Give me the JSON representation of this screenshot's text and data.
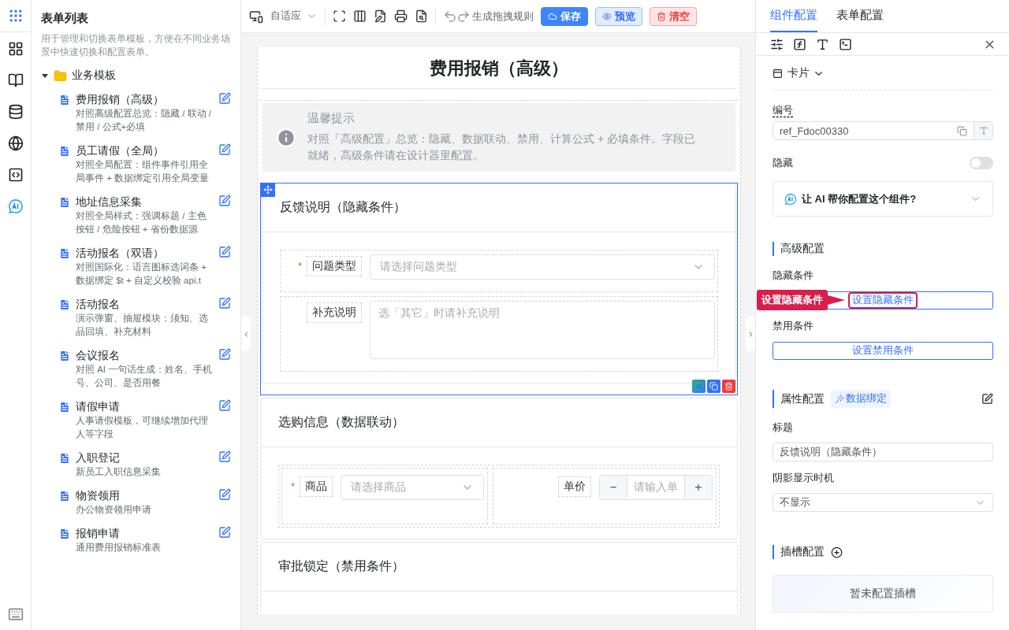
{
  "left_panel": {
    "title": "表单列表",
    "description": "用于管理和切换表单模板，方便在不同业务场景中快速切换和配置表单。",
    "folder": {
      "label": "业务模板",
      "expanded": true,
      "children": [
        {
          "title": "费用报销（高级）",
          "description": "对照高级配置总览：隐藏 / 联动 / 禁用 / 公式+必填"
        },
        {
          "title": "员工请假（全局）",
          "description": "对照全局配置：组件事件引用全局事件 + 数据绑定引用全局变量"
        },
        {
          "title": "地址信息采集",
          "description": "对照全局样式：强调标题 / 主色按钮 / 危险按钮 + 省份数据源"
        },
        {
          "title": "活动报名（双语）",
          "description": "对照国际化：语言图标选词条 + 数据绑定 $t + 自定义校验 api.t"
        },
        {
          "title": "活动报名",
          "description": "演示弹窗、抽屉模块：须知、选品回填、补充材料"
        },
        {
          "title": "会议报名",
          "description": "对照 AI 一句话生成：姓名、手机号、公司、是否用餐"
        },
        {
          "title": "请假申请",
          "description": "人事请假模板，可继续增加代理人等字段"
        },
        {
          "title": "入职登记",
          "description": "新员工入职信息采集"
        },
        {
          "title": "物资领用",
          "description": "办公物资领用申请"
        },
        {
          "title": "报销申请",
          "description": "通用费用报销标准表"
        }
      ]
    }
  },
  "toolbar": {
    "device": "自适应",
    "rules": "生成拖拽规则",
    "buttons": [
      {
        "label": "保存",
        "kind": "primary"
      },
      {
        "label": "预览",
        "kind": "secondary"
      },
      {
        "label": "清空",
        "kind": "danger"
      }
    ]
  },
  "form": {
    "title": "费用报销（高级）",
    "alert": {
      "title": "温馨提示",
      "text": "对照「高级配置」总览：隐藏、数据联动、禁用、计算公式 + 必填条件。字段已就绪，高级条件请在设计器里配置。"
    },
    "sections": [
      {
        "title": "反馈说明（隐藏条件）",
        "selected": true,
        "rows": [
          [
            {
              "kind": "select",
              "label": "问题类型",
              "required_mark": "*",
              "placeholder": "请选择问题类型"
            }
          ],
          [
            {
              "kind": "textarea",
              "label": "补充说明",
              "placeholder": "选「其它」时请补充说明"
            }
          ]
        ]
      },
      {
        "title": "选购信息（数据联动）",
        "selected": false,
        "rows": [
          [
            {
              "kind": "select",
              "label": "商品",
              "required_mark": "*",
              "placeholder": "请选择商品"
            },
            {
              "kind": "number",
              "label": "单价",
              "placeholder": "请输入单",
              "minus": "−",
              "plus": "+"
            }
          ]
        ]
      },
      {
        "title": "审批锁定（禁用条件）",
        "selected": false
      }
    ]
  },
  "right_panel": {
    "tabs": [
      {
        "label": "组件配置",
        "selected": true
      },
      {
        "label": "表单配置",
        "selected": false
      }
    ],
    "component_type": "卡片",
    "id_label": "编号",
    "id_value": "ref_Fdoc00330",
    "hidden": {
      "label": "隐藏",
      "on": false
    },
    "ai_prompt": "让 AI 帮你配置这个组件?",
    "advanced": {
      "title": "高级配置",
      "items": [
        {
          "label": "隐藏条件",
          "button": "设置隐藏条件",
          "highlighted": true
        },
        {
          "label": "禁用条件",
          "button": "设置禁用条件",
          "highlighted": false
        }
      ]
    },
    "properties": {
      "title": "属性配置",
      "binding": "数据绑定",
      "title_label": "标题",
      "title_value": "反馈说明（隐藏条件）",
      "shadow_label": "阴影显示时机",
      "shadow_value": "不显示"
    },
    "slots": {
      "title": "插槽配置",
      "empty": "暂未配置插槽"
    }
  },
  "callout": {
    "text": "设置隐藏条件"
  }
}
